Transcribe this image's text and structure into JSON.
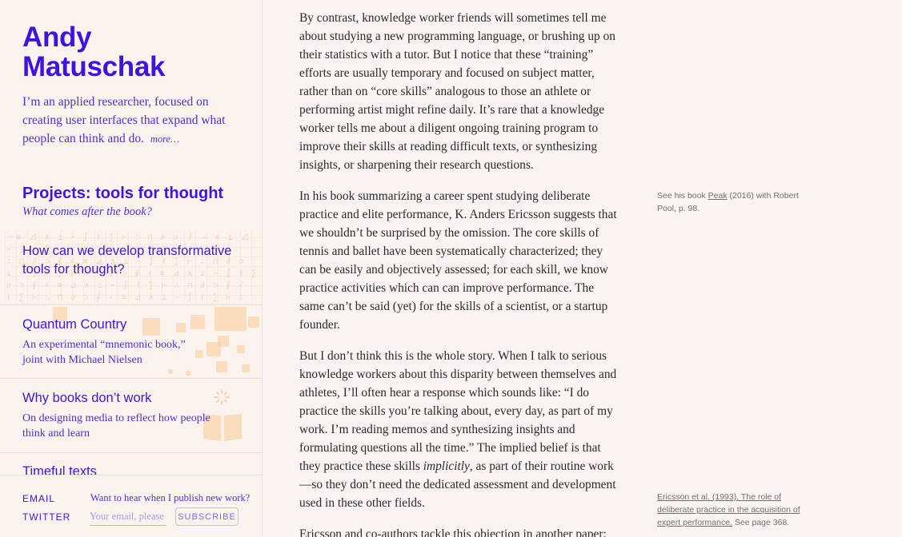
{
  "sidebar": {
    "title": "Andy Matuschak",
    "intro": "I’m an applied researcher, focused on creating user interfaces that expand what people can think and do.",
    "more_link": "more…",
    "projects_heading": "Projects: tools for thought",
    "projects_sub": "What comes after the book?",
    "projects": [
      {
        "title": "How can we develop transformative tools for thought?",
        "desc": ""
      },
      {
        "title": "Quantum Country",
        "desc": "An experimental “mnemonic book,” joint with Michael Nielsen"
      },
      {
        "title": "Why books don’t work",
        "desc": "On designing media to reflect how people think and learn"
      },
      {
        "title": "Timeful texts",
        "desc": ""
      }
    ],
    "footer": {
      "email_label": "EMAIL",
      "twitter_label": "TWITTER",
      "prompt": "Want to hear when I publish new work?",
      "email_placeholder": "Your email, please",
      "subscribe_label": "SUBSCRIBE"
    }
  },
  "article": {
    "p1": "By contrast, knowledge worker friends will sometimes tell me about studying a new programming language, or brushing up on their statistics with a tutor. But I notice that these “training” efforts are usually temporary and focused on subject matter, rather than on “core skills” analogous to those an athlete or performing artist might refine daily. It’s rare that a knowledge worker tells me about a diligent ongoing training program to improve their skills at reading difficult texts, or synthesizing insights, or sharpening their research questions.",
    "p2": "In his book summarizing a career spent studying deliberate practice and elite performance, K. Anders Ericsson suggests that we shouldn’t be surprised by the omission. The core skills of tennis and ballet have been systematically characterized; they can be easily and objectively assessed; for each skill, we know practice activities which can can improve performance. The same can’t be said (yet) for the skills of a scientist, or a startup founder.",
    "p3_a": "But I don’t think this is the whole story. When I talk to serious knowledge workers about this disparity between themselves and athletes, I’ll often hear a response which sounds like: “I do practice the skills you’re talking about, every day, as part of my work. I’m reading memos and synthesizing insights and formulating questions all the time.” The implied belief is that they practice these skills ",
    "p3_em": "implicitly",
    "p3_b": ", as part of their routine work—so they don’t need the dedicated assessment and development used in these other fields.",
    "p4": "Ericsson and co-authors tackle this objection in another paper:"
  },
  "sidenotes": {
    "n1_pre": "See his book ",
    "n1_link": "Peak",
    "n1_post": " (2016) with Robert Pool, p. 98.",
    "n2_link": "Ericsson et al. (1993). The role of deliberate practice in the acquisition of expert performance.",
    "n2_post": " See page 368."
  },
  "colors": {
    "accent": "#3d14e0",
    "background": "#fdf4f1",
    "decoration": "#f7cb96"
  }
}
